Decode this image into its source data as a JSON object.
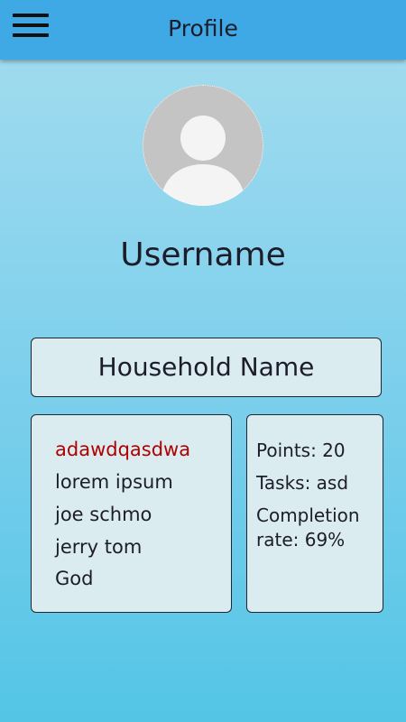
{
  "header": {
    "title": "Profile"
  },
  "profile": {
    "username": "Username",
    "household_name": "Household Name"
  },
  "members": [
    "adawdqasdwa",
    "lorem ipsum",
    "joe schmo",
    "jerry tom",
    "God"
  ],
  "stats": {
    "points": "Points: 20",
    "tasks": "Tasks: asd",
    "completion": "Completion rate: 69%"
  },
  "colors": {
    "appbar": "#3fa9e6",
    "highlight_member": "#b00000",
    "card_background": "#dbecf0"
  },
  "icons": {
    "menu": "menu-icon",
    "avatar": "default-user-avatar"
  }
}
